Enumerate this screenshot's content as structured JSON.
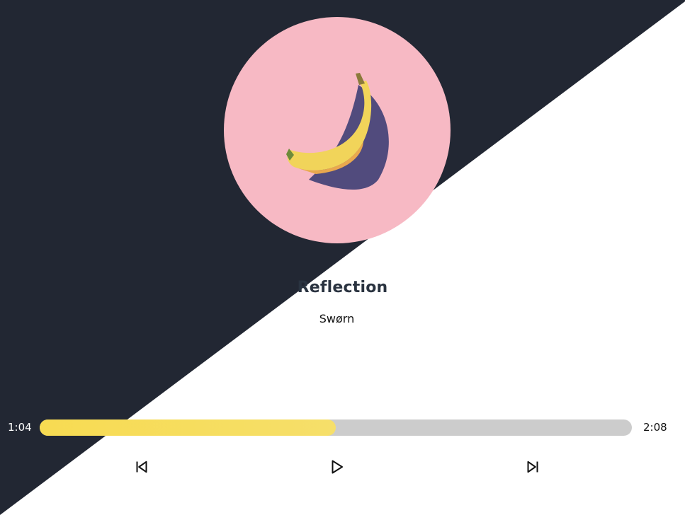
{
  "track": {
    "title": "Reflection",
    "artist": "Swørn",
    "album_art": "banana-icon"
  },
  "player": {
    "elapsed": "1:04",
    "duration": "2:08",
    "progress": 0.5
  },
  "controls": {
    "previous_icon": "skip-back-icon",
    "play_icon": "play-icon",
    "next_icon": "skip-forward-icon"
  },
  "colors": {
    "dark_background": "#222733",
    "light_background": "#ffffff",
    "album_background": "#f7b9c4",
    "progress_fill": "#f7db52",
    "progress_track": "#cccccc"
  }
}
